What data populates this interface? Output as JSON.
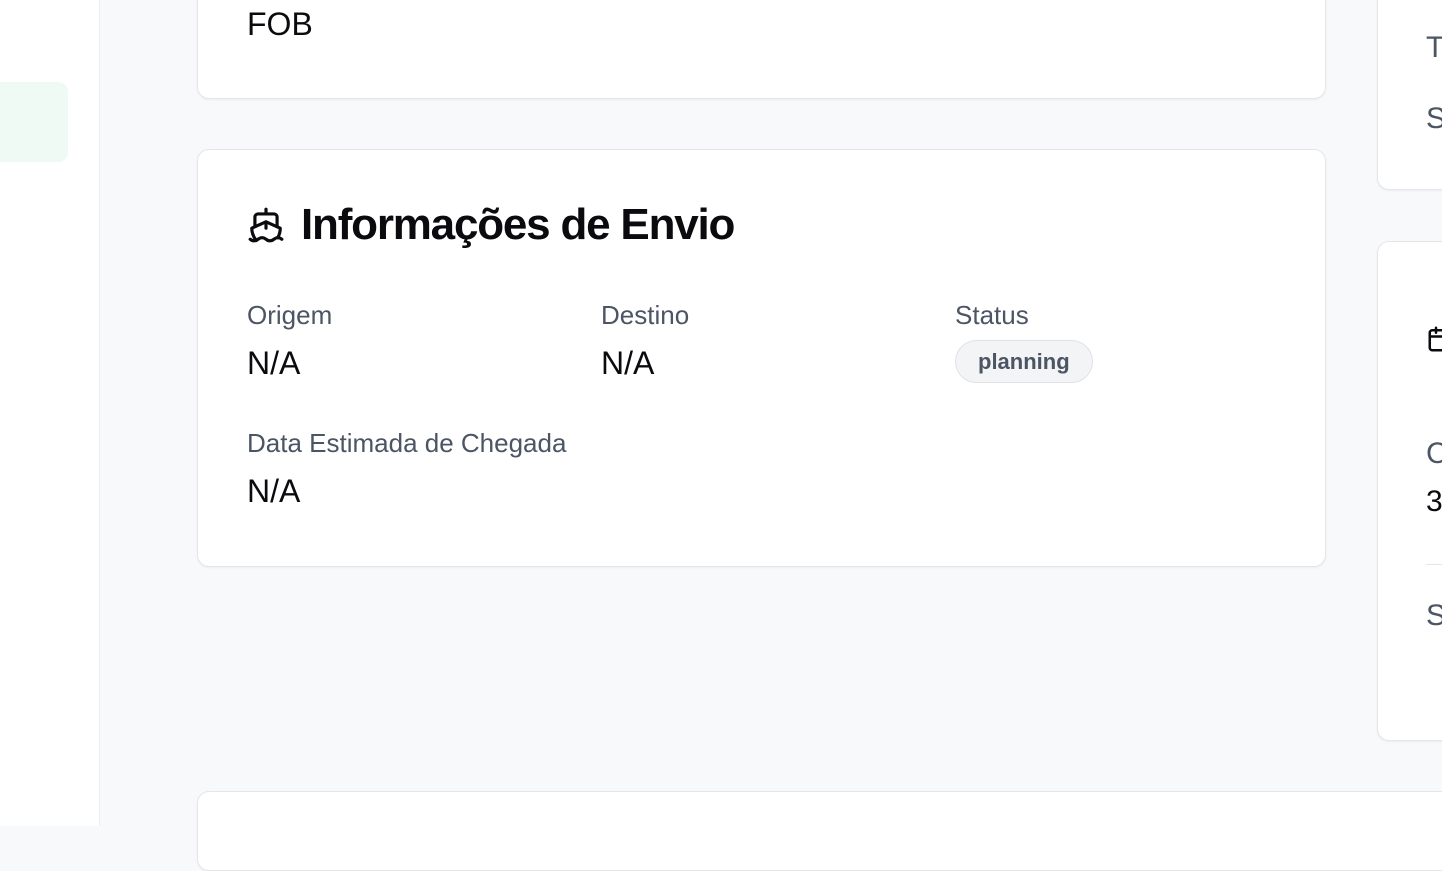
{
  "top_card": {
    "value": "FOB"
  },
  "shipping": {
    "title": "Informações de Envio",
    "icon": "ship-icon",
    "fields": {
      "origin": {
        "label": "Origem",
        "value": "N/A"
      },
      "destination": {
        "label": "Destino",
        "value": "N/A"
      },
      "status": {
        "label": "Status",
        "value": "planning"
      },
      "eta": {
        "label": "Data Estimada de Chegada",
        "value": "N/A"
      }
    }
  },
  "right_panel": {
    "top_card": {
      "line1": "T",
      "line2": "S"
    },
    "bottom_card": {
      "icon": "calendar-icon",
      "label": "C",
      "value": "3",
      "footer": "S"
    }
  },
  "colors": {
    "page_bg": "#f8f9fb",
    "card_border": "#e4e6eb",
    "muted_text": "#4b5563",
    "sidebar_active": "#effaf5",
    "badge_bg": "#f3f4f6"
  }
}
